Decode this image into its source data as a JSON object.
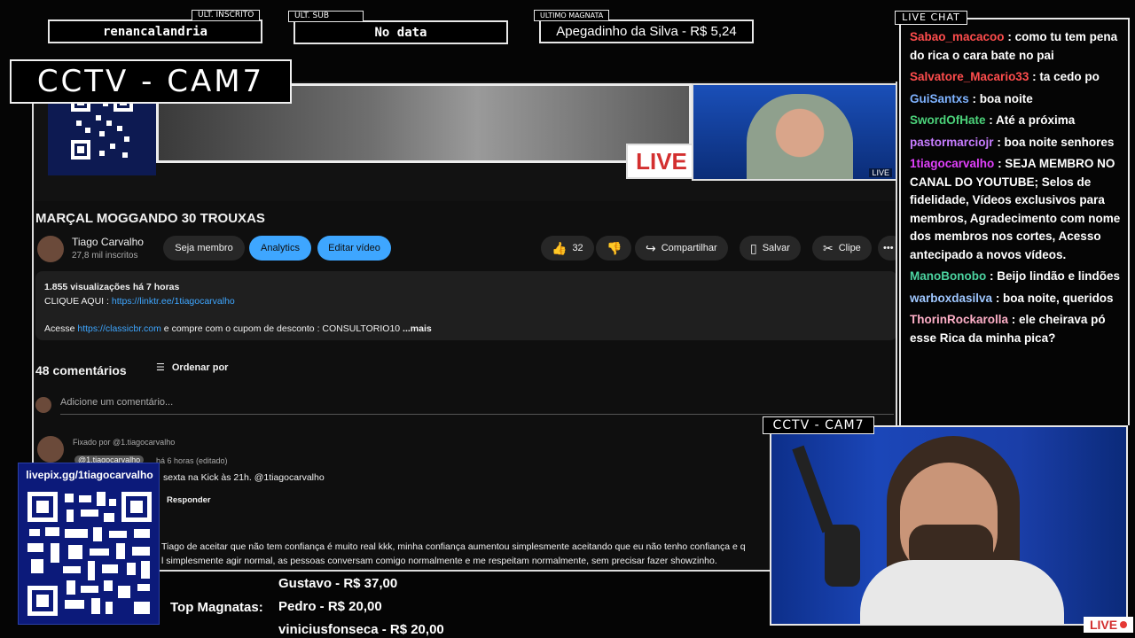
{
  "top_stats": {
    "inscrito_tag": "ULT. INSCRITO",
    "inscrito_value": "renancalandria",
    "sub_tag": "ULT. SUB",
    "sub_value": "No data",
    "magnata_tag": "ULTIMO MAGNATA",
    "magnata_value": "Apegadinho da Silva - R$ 5,24"
  },
  "cctv": {
    "main_label": "CCTV - CAM7",
    "small_label": "CCTV - CAM7"
  },
  "video": {
    "live_sign": "LIVE",
    "cam_live": "LIVE",
    "title": "MARÇAL MOGGANDO 30 TROUXAS",
    "channel_name": "Tiago Carvalho",
    "channel_subs": "27,8 mil inscritos",
    "join_button": "Seja membro",
    "analytics_button": "Analytics",
    "edit_button": "Editar vídeo",
    "like_count": "32",
    "share_label": "Compartilhar",
    "save_label": "Salvar",
    "clip_label": "Clipe",
    "more_label": "•••"
  },
  "description": {
    "stats": "1.855 visualizações  há 7 horas",
    "line1_prefix": "CLIQUE AQUI : ",
    "line1_link": "https://linktr.ee/1tiagocarvalho",
    "line2_prefix": "Acesse ",
    "line2_link": "https://classicbr.com",
    "line2_suffix": " e compre com o cupom de desconto : CONSULTORIO10",
    "more": " ...mais"
  },
  "comments": {
    "count": "48 comentários",
    "sort": "Ordenar por",
    "add_placeholder": "Adicione um comentário...",
    "pinned_by": "Fixado por @1.tiagocarvalho",
    "author": "@1.tiagocarvalho",
    "time": "há 6 horas (editado)",
    "text": "sexta na Kick às 21h. @1tiagocarvalho",
    "reply": "Responder",
    "comment2_line1": "Tiago de aceitar que não tem confiança é muito real kkk, minha confiança aumentou simplesmente aceitando que eu não tenho confiança e q",
    "comment2_line2": "l simplesmente agir normal, as pessoas conversam comigo normalmente e me respeitam normalmente, sem precisar fazer showzinho."
  },
  "livepix": {
    "url": "livepix.gg/1tiagocarvalho"
  },
  "top_magnatas": {
    "label": "Top Magnatas:",
    "items": [
      "Gustavo - R$ 37,00",
      "Pedro - R$ 20,00",
      "viniciusfonseca - R$ 20,00"
    ]
  },
  "chat": {
    "tag": "LIVE CHAT",
    "messages": [
      {
        "user": "Sabao_macacoo",
        "color": "#ff4d4d",
        "text": ": como tu tem pena do rica o cara bate no pai"
      },
      {
        "user": "Salvatore_Macario33",
        "color": "#ff4d4d",
        "text": ": ta cedo po"
      },
      {
        "user": "GuiSantxs",
        "color": "#7fb3ff",
        "text": ": boa noite"
      },
      {
        "user": "SwordOfHate",
        "color": "#4cd37a",
        "text": ": Até a próxima"
      },
      {
        "user": "pastormarciojr",
        "color": "#c77dff",
        "text": ": boa noite senhores"
      },
      {
        "user": "1tiagocarvalho",
        "color": "#e040fb",
        "text": ": SEJA MEMBRO NO CANAL DO YOUTUBE; Selos de fidelidade, Vídeos exclusivos para membros, Agradecimento com nome dos membros nos cortes, Acesso antecipado a novos vídeos."
      },
      {
        "user": "ManoBonobo",
        "color": "#4cd3a0",
        "text": ": Beijo lindão e lindões"
      },
      {
        "user": "warboxdasilva",
        "color": "#9fc7ff",
        "text": ": boa noite, queridos"
      },
      {
        "user": "ThorinRockarolla",
        "color": "#ffb0c8",
        "text": ": ele cheirava pó esse Rica da minha pica?"
      }
    ]
  },
  "bottom_cam": {
    "live": "LIVE"
  }
}
